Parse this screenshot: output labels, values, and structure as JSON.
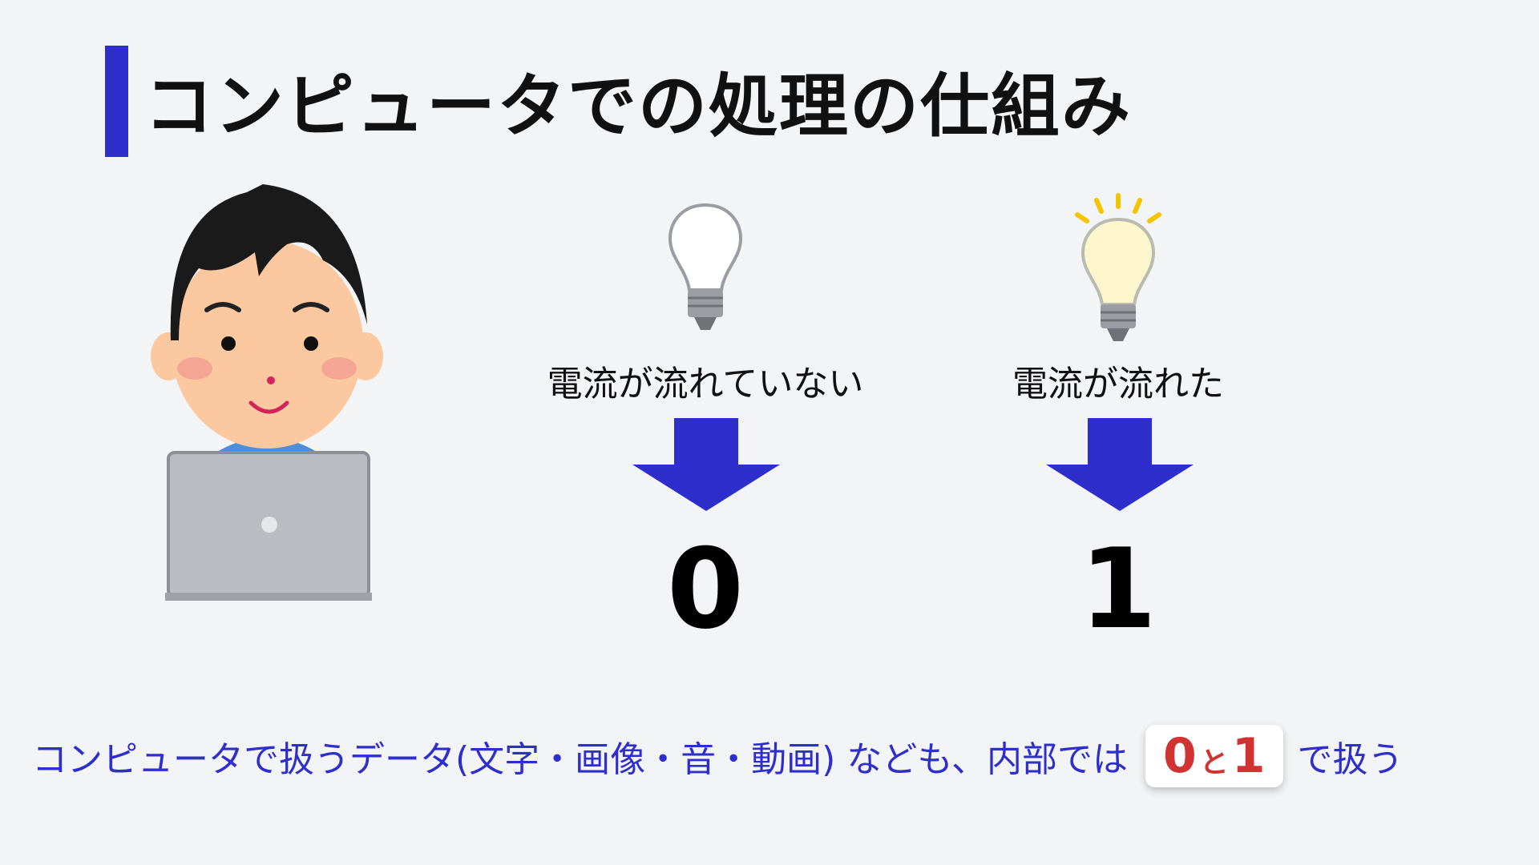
{
  "title": "コンピュータでの処理の仕組み",
  "illustrations": {
    "person": "person-with-laptop",
    "bulb_off": "lightbulb-off-icon",
    "bulb_on": "lightbulb-on-icon"
  },
  "states": [
    {
      "label": "電流が流れていない",
      "value": "0"
    },
    {
      "label": "電流が流れた",
      "value": "1"
    }
  ],
  "footer": {
    "before": "コンピュータで扱うデータ(文字・画像・音・動画) なども、内部では",
    "badge_zero": "0",
    "badge_and": "と",
    "badge_one": "1",
    "after": "で扱う"
  },
  "colors": {
    "accent": "#2e2ecc",
    "highlight": "#d13333",
    "background": "#f3f4f6"
  }
}
